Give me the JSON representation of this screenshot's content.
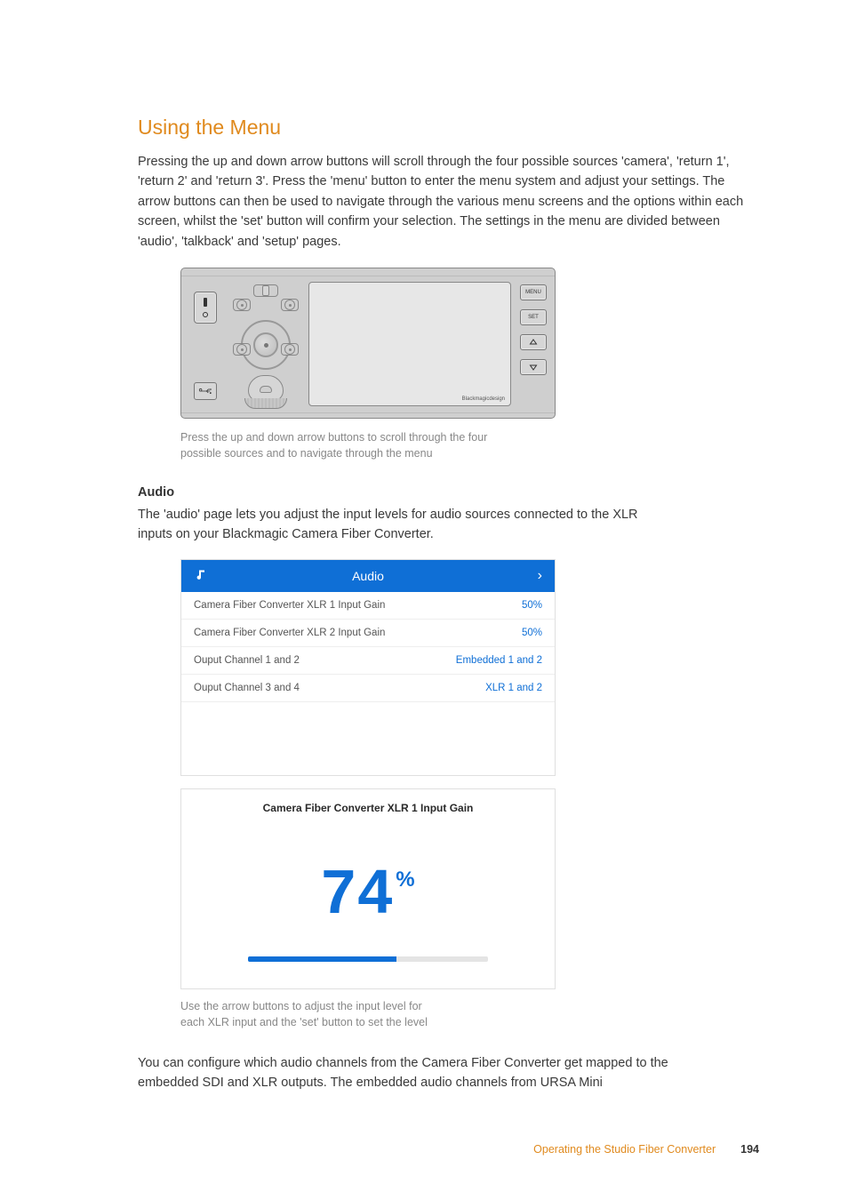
{
  "heading": "Using the Menu",
  "intro": "Pressing the up and down arrow buttons will scroll through the four possible sources 'camera', 'return 1', 'return 2' and 'return 3'. Press the 'menu' button to enter the menu system and adjust your settings. The arrow buttons can then be used to navigate through the various menu screens and the options within each screen, whilst the 'set' button will confirm your selection. The settings in the menu are divided between 'audio', 'talkback' and 'setup' pages.",
  "device": {
    "buttons": {
      "menu": "MENU",
      "set": "SET"
    },
    "signature": "Blackmagicdesign"
  },
  "caption1_line1": "Press the up and down arrow buttons to scroll through the four",
  "caption1_line2": "possible sources and to navigate through the menu",
  "audio_subhead": "Audio",
  "audio_body": "The 'audio' page lets you adjust the input levels for audio sources connected to the XLR inputs on your Blackmagic Camera Fiber Converter.",
  "menu": {
    "title": "Audio",
    "chevron": "›",
    "rows": [
      {
        "label": "Camera Fiber Converter XLR 1 Input Gain",
        "value": "50%"
      },
      {
        "label": "Camera Fiber Converter XLR 2 Input Gain",
        "value": "50%"
      },
      {
        "label": "Ouput Channel 1 and 2",
        "value": "Embedded 1 and 2"
      },
      {
        "label": "Ouput Channel 3 and 4",
        "value": "XLR 1 and 2"
      }
    ]
  },
  "gain": {
    "title": "Camera Fiber Converter XLR 1 Input Gain",
    "value": "74",
    "percent_symbol": "%",
    "fill_percent": 62
  },
  "caption2_line1": "Use the arrow buttons to adjust the input level for",
  "caption2_line2": "each XLR input and the 'set' button to set the level",
  "closing": "You can configure which audio channels from the Camera Fiber Converter get mapped to the embedded SDI and XLR outputs. The embedded audio channels from URSA Mini",
  "footer": {
    "section": "Operating the Studio Fiber Converter",
    "page": "194"
  }
}
